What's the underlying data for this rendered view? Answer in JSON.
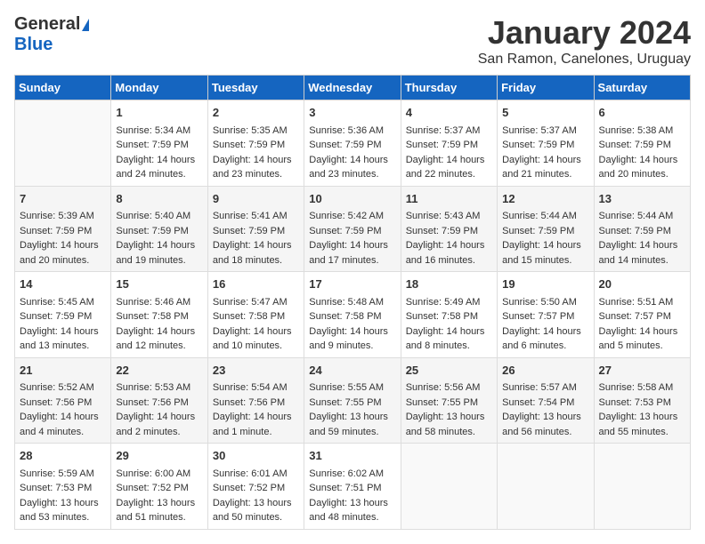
{
  "header": {
    "logo_general": "General",
    "logo_blue": "Blue",
    "month_year": "January 2024",
    "location": "San Ramon, Canelones, Uruguay"
  },
  "days_of_week": [
    "Sunday",
    "Monday",
    "Tuesday",
    "Wednesday",
    "Thursday",
    "Friday",
    "Saturday"
  ],
  "weeks": [
    [
      {
        "day": "",
        "empty": true
      },
      {
        "day": "1",
        "sunrise": "Sunrise: 5:34 AM",
        "sunset": "Sunset: 7:59 PM",
        "daylight": "Daylight: 14 hours and 24 minutes."
      },
      {
        "day": "2",
        "sunrise": "Sunrise: 5:35 AM",
        "sunset": "Sunset: 7:59 PM",
        "daylight": "Daylight: 14 hours and 23 minutes."
      },
      {
        "day": "3",
        "sunrise": "Sunrise: 5:36 AM",
        "sunset": "Sunset: 7:59 PM",
        "daylight": "Daylight: 14 hours and 23 minutes."
      },
      {
        "day": "4",
        "sunrise": "Sunrise: 5:37 AM",
        "sunset": "Sunset: 7:59 PM",
        "daylight": "Daylight: 14 hours and 22 minutes."
      },
      {
        "day": "5",
        "sunrise": "Sunrise: 5:37 AM",
        "sunset": "Sunset: 7:59 PM",
        "daylight": "Daylight: 14 hours and 21 minutes."
      },
      {
        "day": "6",
        "sunrise": "Sunrise: 5:38 AM",
        "sunset": "Sunset: 7:59 PM",
        "daylight": "Daylight: 14 hours and 20 minutes."
      }
    ],
    [
      {
        "day": "7",
        "sunrise": "Sunrise: 5:39 AM",
        "sunset": "Sunset: 7:59 PM",
        "daylight": "Daylight: 14 hours and 20 minutes."
      },
      {
        "day": "8",
        "sunrise": "Sunrise: 5:40 AM",
        "sunset": "Sunset: 7:59 PM",
        "daylight": "Daylight: 14 hours and 19 minutes."
      },
      {
        "day": "9",
        "sunrise": "Sunrise: 5:41 AM",
        "sunset": "Sunset: 7:59 PM",
        "daylight": "Daylight: 14 hours and 18 minutes."
      },
      {
        "day": "10",
        "sunrise": "Sunrise: 5:42 AM",
        "sunset": "Sunset: 7:59 PM",
        "daylight": "Daylight: 14 hours and 17 minutes."
      },
      {
        "day": "11",
        "sunrise": "Sunrise: 5:43 AM",
        "sunset": "Sunset: 7:59 PM",
        "daylight": "Daylight: 14 hours and 16 minutes."
      },
      {
        "day": "12",
        "sunrise": "Sunrise: 5:44 AM",
        "sunset": "Sunset: 7:59 PM",
        "daylight": "Daylight: 14 hours and 15 minutes."
      },
      {
        "day": "13",
        "sunrise": "Sunrise: 5:44 AM",
        "sunset": "Sunset: 7:59 PM",
        "daylight": "Daylight: 14 hours and 14 minutes."
      }
    ],
    [
      {
        "day": "14",
        "sunrise": "Sunrise: 5:45 AM",
        "sunset": "Sunset: 7:59 PM",
        "daylight": "Daylight: 14 hours and 13 minutes."
      },
      {
        "day": "15",
        "sunrise": "Sunrise: 5:46 AM",
        "sunset": "Sunset: 7:58 PM",
        "daylight": "Daylight: 14 hours and 12 minutes."
      },
      {
        "day": "16",
        "sunrise": "Sunrise: 5:47 AM",
        "sunset": "Sunset: 7:58 PM",
        "daylight": "Daylight: 14 hours and 10 minutes."
      },
      {
        "day": "17",
        "sunrise": "Sunrise: 5:48 AM",
        "sunset": "Sunset: 7:58 PM",
        "daylight": "Daylight: 14 hours and 9 minutes."
      },
      {
        "day": "18",
        "sunrise": "Sunrise: 5:49 AM",
        "sunset": "Sunset: 7:58 PM",
        "daylight": "Daylight: 14 hours and 8 minutes."
      },
      {
        "day": "19",
        "sunrise": "Sunrise: 5:50 AM",
        "sunset": "Sunset: 7:57 PM",
        "daylight": "Daylight: 14 hours and 6 minutes."
      },
      {
        "day": "20",
        "sunrise": "Sunrise: 5:51 AM",
        "sunset": "Sunset: 7:57 PM",
        "daylight": "Daylight: 14 hours and 5 minutes."
      }
    ],
    [
      {
        "day": "21",
        "sunrise": "Sunrise: 5:52 AM",
        "sunset": "Sunset: 7:56 PM",
        "daylight": "Daylight: 14 hours and 4 minutes."
      },
      {
        "day": "22",
        "sunrise": "Sunrise: 5:53 AM",
        "sunset": "Sunset: 7:56 PM",
        "daylight": "Daylight: 14 hours and 2 minutes."
      },
      {
        "day": "23",
        "sunrise": "Sunrise: 5:54 AM",
        "sunset": "Sunset: 7:56 PM",
        "daylight": "Daylight: 14 hours and 1 minute."
      },
      {
        "day": "24",
        "sunrise": "Sunrise: 5:55 AM",
        "sunset": "Sunset: 7:55 PM",
        "daylight": "Daylight: 13 hours and 59 minutes."
      },
      {
        "day": "25",
        "sunrise": "Sunrise: 5:56 AM",
        "sunset": "Sunset: 7:55 PM",
        "daylight": "Daylight: 13 hours and 58 minutes."
      },
      {
        "day": "26",
        "sunrise": "Sunrise: 5:57 AM",
        "sunset": "Sunset: 7:54 PM",
        "daylight": "Daylight: 13 hours and 56 minutes."
      },
      {
        "day": "27",
        "sunrise": "Sunrise: 5:58 AM",
        "sunset": "Sunset: 7:53 PM",
        "daylight": "Daylight: 13 hours and 55 minutes."
      }
    ],
    [
      {
        "day": "28",
        "sunrise": "Sunrise: 5:59 AM",
        "sunset": "Sunset: 7:53 PM",
        "daylight": "Daylight: 13 hours and 53 minutes."
      },
      {
        "day": "29",
        "sunrise": "Sunrise: 6:00 AM",
        "sunset": "Sunset: 7:52 PM",
        "daylight": "Daylight: 13 hours and 51 minutes."
      },
      {
        "day": "30",
        "sunrise": "Sunrise: 6:01 AM",
        "sunset": "Sunset: 7:52 PM",
        "daylight": "Daylight: 13 hours and 50 minutes."
      },
      {
        "day": "31",
        "sunrise": "Sunrise: 6:02 AM",
        "sunset": "Sunset: 7:51 PM",
        "daylight": "Daylight: 13 hours and 48 minutes."
      },
      {
        "day": "",
        "empty": true
      },
      {
        "day": "",
        "empty": true
      },
      {
        "day": "",
        "empty": true
      }
    ]
  ]
}
